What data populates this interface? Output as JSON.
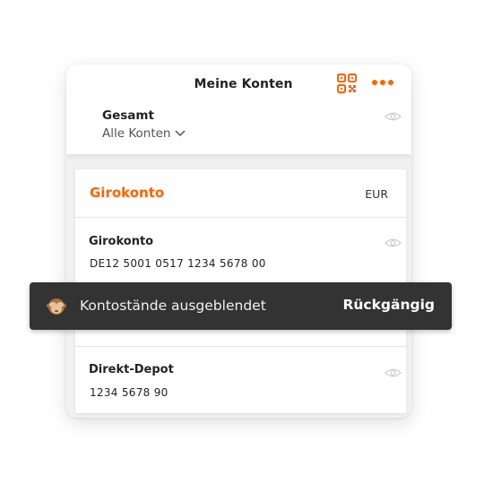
{
  "header": {
    "title": "Meine Konten",
    "qr_icon": "qr-code-icon",
    "more_icon": "more-dots-icon",
    "accent_color": "#ff6200"
  },
  "overview": {
    "label": "Gesamt",
    "filter": "Alle Konten",
    "eye_icon": "eye-icon"
  },
  "section": {
    "title": "Girokonto",
    "currency": "EUR"
  },
  "accounts": [
    {
      "name": "Girokonto",
      "number": "DE12 5001 0517 1234 5678 00"
    },
    {
      "name": "Direkt-Depot",
      "number": "1234 5678 90"
    }
  ],
  "toast": {
    "emoji": "see-no-evil-monkey-icon",
    "message": "Kontostände ausgeblendet",
    "action": "Rückgängig",
    "background": "#333333"
  }
}
